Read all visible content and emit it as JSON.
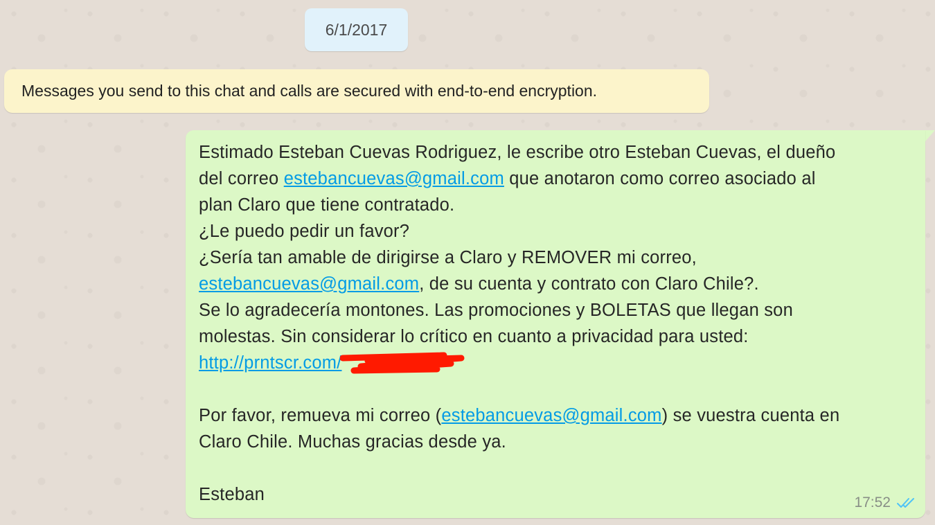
{
  "date_divider": "6/1/2017",
  "encryption_notice": "Messages you send to this chat and calls are secured with end-to-end encryption.",
  "message": {
    "line1": "Estimado Esteban Cuevas Rodriguez, le escribe otro Esteban Cuevas, el dueño",
    "line2_pre": "del correo ",
    "line2_link": "estebancuevas@gmail.com",
    "line2_post": " que anotaron como correo asociado al",
    "line3": "plan Claro que tiene contratado.",
    "line4": "¿Le puedo pedir un favor?",
    "line5": "¿Sería tan amable de dirigirse a Claro y REMOVER mi correo,",
    "line6_link": "estebancuevas@gmail.com",
    "line6_post": ", de su cuenta y contrato con Claro Chile?.",
    "line7": "Se lo agradecería montones. Las promociones y BOLETAS que llegan son",
    "line8": "molestas. Sin considerar lo crítico en cuanto a privacidad para usted:",
    "line9_link": "http://prntscr.com/",
    "line11_pre": "Por favor, remueva mi correo (",
    "line11_link": "estebancuevas@gmail.com",
    "line11_post": ") se vuestra cuenta en",
    "line12": "Claro Chile. Muchas gracias desde ya.",
    "line14": "Esteban",
    "time": "17:52",
    "status_icon": "double-check-read-icon"
  },
  "colors": {
    "outgoing_bubble": "#dcf8c6",
    "notice_bubble": "#fcf4cb",
    "date_bubble": "#e1f2fb",
    "link": "#039be5",
    "read_ticks": "#4fc3f7",
    "redaction": "#ff0000"
  }
}
